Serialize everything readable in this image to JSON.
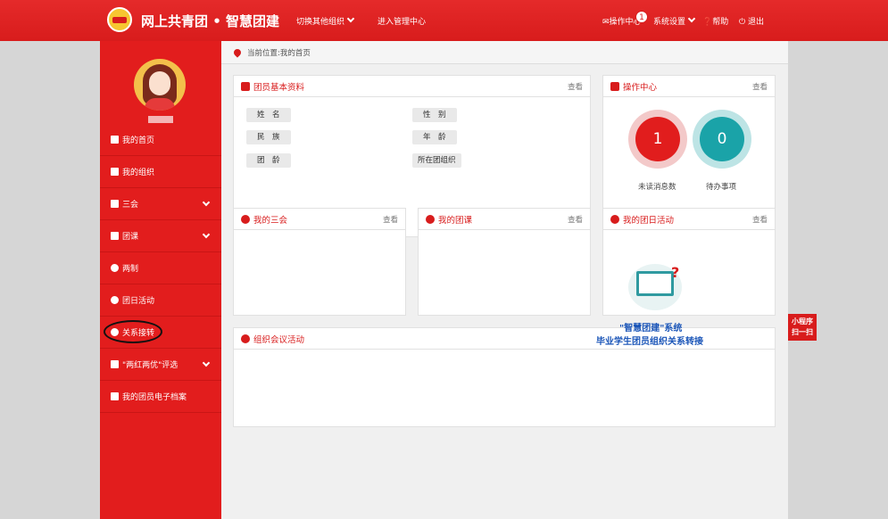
{
  "header": {
    "brand": "网上共青团 • 智慧团建",
    "switch_org": "切换其他组织",
    "admin_center": "进入管理中心",
    "ops_center": "操作中心",
    "ops_badge": "1",
    "settings": "系统设置",
    "help": "帮助",
    "logout": "退出"
  },
  "sidebar": {
    "items": [
      {
        "label": "我的首页",
        "icon": "home-icon"
      },
      {
        "label": "我的组织",
        "icon": "users-icon"
      },
      {
        "label": "三会",
        "icon": "edit-icon"
      },
      {
        "label": "团课",
        "icon": "folder-icon"
      },
      {
        "label": "两制",
        "icon": "target-icon"
      },
      {
        "label": "团日活动",
        "icon": "recycle-icon"
      },
      {
        "label": "关系接转",
        "icon": "refresh-icon"
      },
      {
        "label": "\"两红两优\"评选",
        "icon": "edit-icon"
      },
      {
        "label": "我的团员电子档案",
        "icon": "file-icon"
      }
    ]
  },
  "breadcrumb": "当前位置:我的首页",
  "profile": {
    "title": "团员基本资料",
    "more": "查看",
    "fields": [
      "姓　名",
      "民　族",
      "团　龄",
      "性　别",
      "年　龄",
      "所在团组织"
    ]
  },
  "ops": {
    "title": "操作中心",
    "more": "查看",
    "unread_count": "1",
    "unread_label": "未读消息数",
    "todo_count": "0",
    "todo_label": "待办事项"
  },
  "cards": {
    "meetings": {
      "title": "我的三会",
      "more": "查看"
    },
    "courses": {
      "title": "我的团课",
      "more": "查看"
    },
    "activities": {
      "title": "我的团日活动",
      "more": "查看"
    },
    "org_meetings": {
      "title": "组织会议活动"
    }
  },
  "promo": {
    "line1": "\"智慧团建\"系统",
    "line2": "毕业学生团员组织关系转接"
  },
  "miniprogram": {
    "line1": "小程序",
    "line2": "扫一扫"
  },
  "colors": {
    "primary": "#d81c1c",
    "teal": "#1aa3a8",
    "link_blue": "#1a55b8"
  }
}
